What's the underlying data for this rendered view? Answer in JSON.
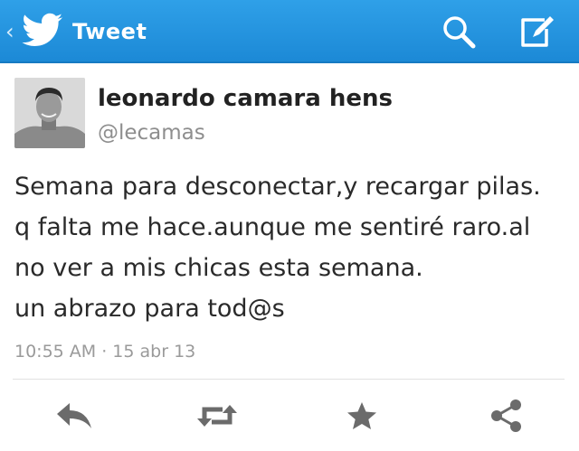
{
  "topbar": {
    "title": "Tweet",
    "icons": {
      "back": "chevron-left-icon",
      "logo": "twitter-bird-icon",
      "search": "search-icon",
      "compose": "compose-icon"
    },
    "background_color": "#1c89d6"
  },
  "tweet": {
    "author_name": "leonardo camara hens",
    "author_handle": "@lecamas",
    "text_lines": [
      "Semana para desconectar,y recargar pilas.",
      "q falta me hace.aunque me sentiré raro.al",
      "no ver a mis chicas esta semana.",
      "un abrazo para tod@s"
    ],
    "timestamp": "10:55 AM · 15 abr 13"
  },
  "actions": [
    {
      "name": "reply",
      "icon": "reply-icon"
    },
    {
      "name": "retweet",
      "icon": "retweet-icon"
    },
    {
      "name": "favorite",
      "icon": "star-icon"
    },
    {
      "name": "share",
      "icon": "share-icon"
    }
  ],
  "colors": {
    "action_icon": "#6b6b6b",
    "handle_text": "#8e8e8e"
  }
}
